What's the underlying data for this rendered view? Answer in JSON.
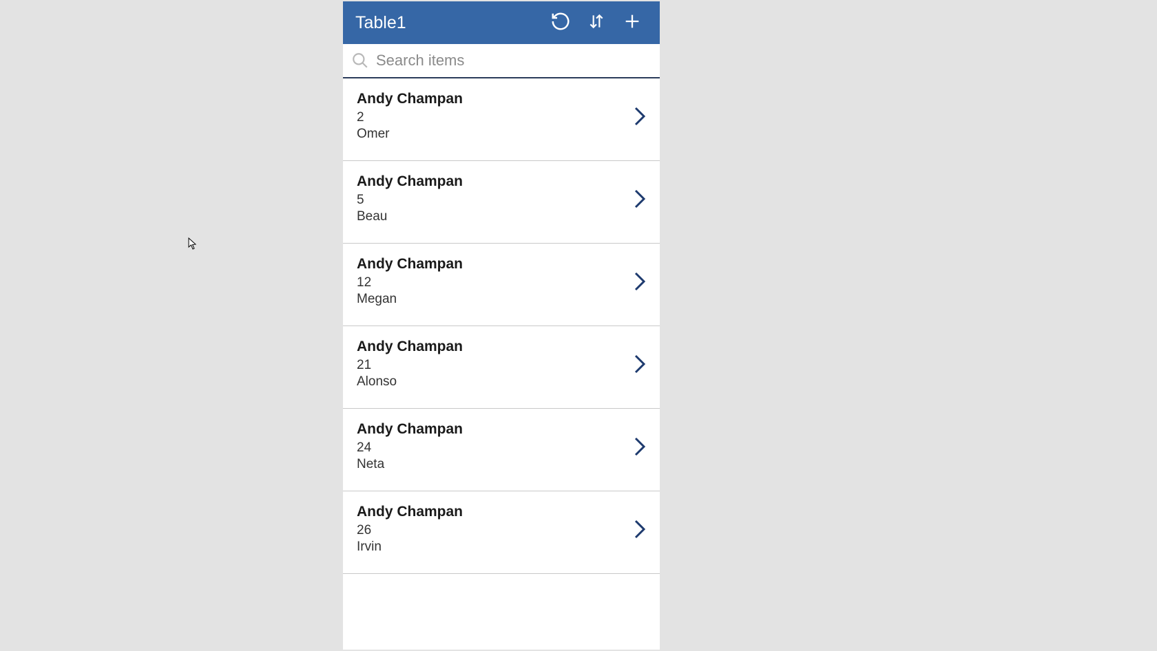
{
  "header": {
    "title": "Table1"
  },
  "search": {
    "placeholder": "Search items",
    "value": ""
  },
  "items": [
    {
      "title": "Andy Champan",
      "number": "2",
      "subtitle": "Omer"
    },
    {
      "title": "Andy Champan",
      "number": "5",
      "subtitle": "Beau"
    },
    {
      "title": "Andy Champan",
      "number": "12",
      "subtitle": "Megan"
    },
    {
      "title": "Andy Champan",
      "number": "21",
      "subtitle": "Alonso"
    },
    {
      "title": "Andy Champan",
      "number": "24",
      "subtitle": "Neta"
    },
    {
      "title": "Andy Champan",
      "number": "26",
      "subtitle": "Irvin"
    }
  ],
  "colors": {
    "headerBg": "#3667a6",
    "chevron": "#1d3a6e",
    "pageBg": "#e3e3e3"
  }
}
